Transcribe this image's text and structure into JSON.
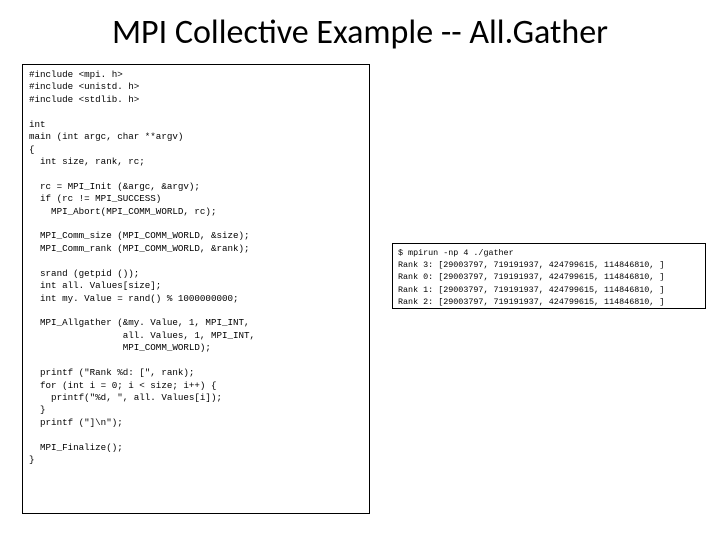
{
  "title": "MPI Collective Example -- All.Gather",
  "code_left": "#include <mpi. h>\n#include <unistd. h>\n#include <stdlib. h>\n\nint\nmain (int argc, char **argv)\n{\n  int size, rank, rc;\n\n  rc = MPI_Init (&argc, &argv);\n  if (rc != MPI_SUCCESS)\n    MPI_Abort(MPI_COMM_WORLD, rc);\n\n  MPI_Comm_size (MPI_COMM_WORLD, &size);\n  MPI_Comm_rank (MPI_COMM_WORLD, &rank);\n\n  srand (getpid ());\n  int all. Values[size];\n  int my. Value = rand() % 1000000000;\n\n  MPI_Allgather (&my. Value, 1, MPI_INT,\n                 all. Values, 1, MPI_INT,\n                 MPI_COMM_WORLD);\n\n  printf (\"Rank %d: [\", rank);\n  for (int i = 0; i < size; i++) {\n    printf(\"%d, \", all. Values[i]);\n  }\n  printf (\"]\\n\");\n\n  MPI_Finalize();\n}",
  "code_right": "$ mpirun -np 4 ./gather\nRank 3: [29003797, 719191937, 424799615, 114846810, ]\nRank 0: [29003797, 719191937, 424799615, 114846810, ]\nRank 1: [29003797, 719191937, 424799615, 114846810, ]\nRank 2: [29003797, 719191937, 424799615, 114846810, ]"
}
